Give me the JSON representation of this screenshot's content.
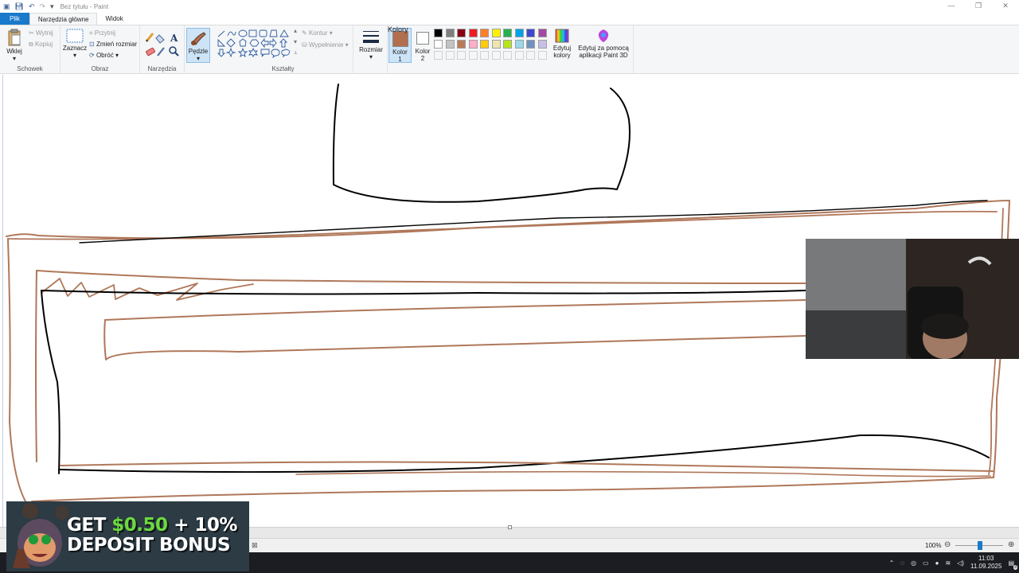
{
  "window": {
    "title": "Bez tytułu - Paint",
    "controls": {
      "minimize": "—",
      "restore": "❐",
      "close": "✕"
    }
  },
  "tabs": [
    {
      "label": "Plik"
    },
    {
      "label": "Narzędzia główne"
    },
    {
      "label": "Widok"
    }
  ],
  "ribbon": {
    "clipboard": {
      "paste": "Wklej",
      "cut": "Wytnij",
      "copy": "Kopiuj",
      "group": "Schowek"
    },
    "image": {
      "select": "Zaznacz",
      "crop": "Przytnij",
      "resize": "Zmień rozmiar",
      "rotate": "Obróć",
      "group": "Obraz"
    },
    "tools": {
      "group": "Narzędzia"
    },
    "brushes": {
      "label": "Pędzle"
    },
    "shapes": {
      "outline": "Kontur",
      "fill": "Wypełnienie",
      "group": "Kształty"
    },
    "size": {
      "label": "Rozmiar"
    },
    "color1": {
      "label_line1": "Kolor",
      "label_line2": "1",
      "value": "#b16f50"
    },
    "color2": {
      "label_line1": "Kolor",
      "label_line2": "2",
      "value": "#ffffff"
    },
    "colors_group": "Kolory",
    "edit_colors": {
      "line1": "Edytuj",
      "line2": "kolory"
    },
    "paint3d": {
      "line1": "Edytuj za pomocą",
      "line2": "aplikacji Paint 3D"
    },
    "palette_row1": [
      "#000000",
      "#7f7f7f",
      "#880015",
      "#ed1c24",
      "#ff7f27",
      "#fff200",
      "#22b14c",
      "#00a2e8",
      "#3f48cc",
      "#a349a4"
    ],
    "palette_row2": [
      "#ffffff",
      "#c3c3c3",
      "#b97a57",
      "#ffaec9",
      "#ffc90e",
      "#efe4b0",
      "#b5e61d",
      "#99d9ea",
      "#7092be",
      "#c8bfe7"
    ]
  },
  "status": {
    "zoom": "100%"
  },
  "taskbar": {
    "time": "11:03",
    "date": "11.09.2025",
    "notifications": "3"
  },
  "ad": {
    "line1_white": "GET ",
    "line1_green": "$0.50",
    "line1_rest": " + 10%",
    "line2": "DEPOSIT BONUS"
  },
  "colors": {
    "brush_brown": "#b0775a",
    "ink_black": "#000000",
    "file_tab": "#1979ca",
    "taskbar": "#1b1d22"
  }
}
